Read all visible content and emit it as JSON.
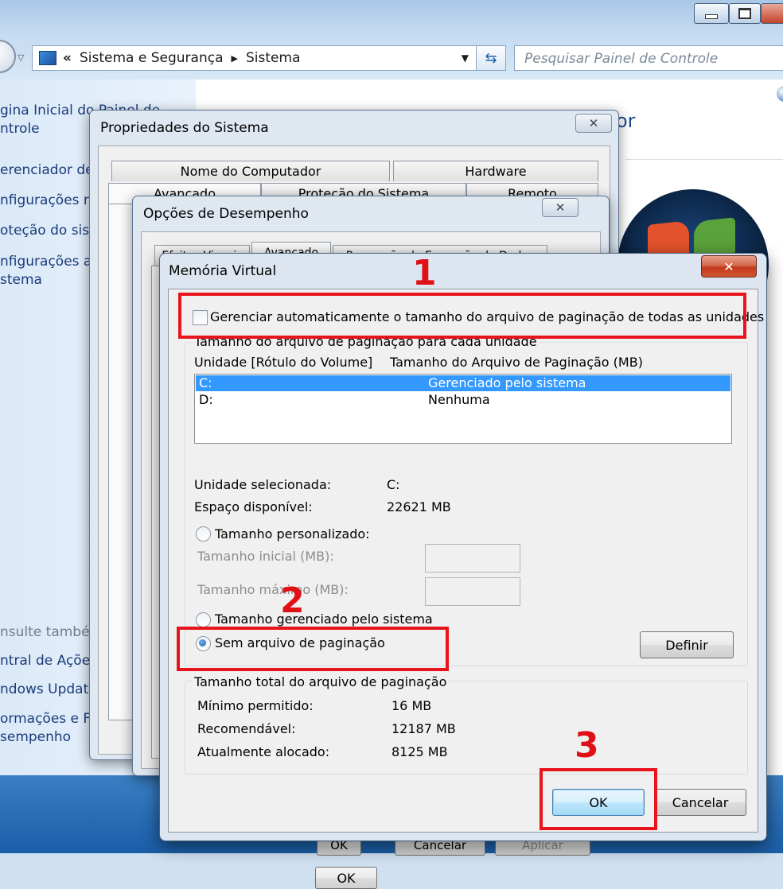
{
  "explorer": {
    "breadcrumb": [
      "Sistema e Segurança",
      "Sistema"
    ],
    "breadcrumb_prefix": "«",
    "search_placeholder": "Pesquisar Painel de Controle",
    "sidebar_links": [
      "gina Inicial do Painel de\nntrole",
      "erenciador de D",
      "nfigurações re",
      "oteção do siste",
      "nfigurações a\nstema"
    ],
    "see_also_label": "nsulte també",
    "see_also_links": [
      "ntral de Ações",
      "ndows Update",
      "ormações e Fe\nsempenho"
    ],
    "content_heading_fragment": "or"
  },
  "system_properties": {
    "title": "Propriedades do Sistema",
    "tabs_row1": [
      "Nome do Computador",
      "Hardware"
    ],
    "tabs_row2": [
      "Avançado",
      "Proteção do Sistema",
      "Remoto"
    ],
    "buttons": [
      "OK",
      "Cancelar",
      "Aplicar"
    ]
  },
  "performance_options": {
    "title": "Opções de Desempenho",
    "tabs": [
      "Efeitos Visuais",
      "Avançado",
      "Prevenção de Execução de Dados"
    ]
  },
  "virtual_memory": {
    "title": "Memória Virtual",
    "auto_manage_label": "Gerenciar automaticamente o tamanho do arquivo de paginação de todas as unidades",
    "auto_manage_checked": false,
    "drives_group_title": "Tamanho do arquivo de paginação para cada unidade",
    "col_drive": "Unidade [Rótulo do Volume]",
    "col_size": "Tamanho do Arquivo de Paginação (MB)",
    "drives": [
      {
        "drive": "C:",
        "size": "Gerenciado pelo sistema",
        "selected": true
      },
      {
        "drive": "D:",
        "size": "Nenhuma",
        "selected": false
      }
    ],
    "selected_drive_label": "Unidade selecionada:",
    "selected_drive_value": "C:",
    "free_space_label": "Espaço disponível:",
    "free_space_value": "22621 MB",
    "custom_size_label": "Tamanho personalizado:",
    "initial_size_label": "Tamanho inicial (MB):",
    "max_size_label": "Tamanho máximo (MB):",
    "system_managed_label": "Tamanho gerenciado pelo sistema",
    "no_paging_label": "Sem arquivo de paginação",
    "selected_option": "no_paging",
    "set_button": "Definir",
    "total_group_title": "Tamanho total do arquivo de paginação",
    "min_allowed_label": "Mínimo permitido:",
    "min_allowed_value": "16 MB",
    "recommended_label": "Recomendável:",
    "recommended_value": "12187 MB",
    "allocated_label": "Atualmente alocado:",
    "allocated_value": "8125 MB",
    "ok_button": "OK",
    "cancel_button": "Cancelar"
  },
  "annotations": {
    "step1": "1",
    "step2": "2",
    "step3": "3",
    "color": "#e8141b"
  },
  "colors": {
    "selection": "#3399ff",
    "link": "#1b3c7a"
  }
}
